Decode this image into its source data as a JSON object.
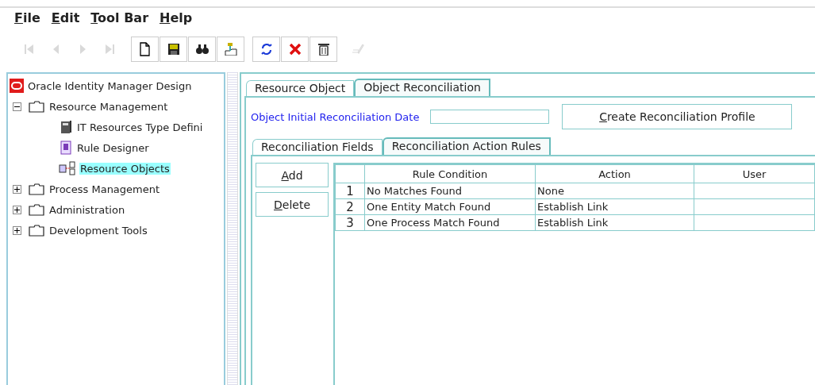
{
  "menu": [
    "File",
    "Edit",
    "Tool Bar",
    "Help"
  ],
  "toolbar": [
    [
      {
        "kind": "first",
        "disabled": true,
        "boxed": false
      },
      {
        "kind": "prev",
        "disabled": true,
        "boxed": false
      },
      {
        "kind": "next",
        "disabled": true,
        "boxed": false
      },
      {
        "kind": "last",
        "disabled": true,
        "boxed": false
      }
    ],
    [
      {
        "kind": "new",
        "disabled": false,
        "boxed": true
      },
      {
        "kind": "save",
        "disabled": false,
        "boxed": true
      },
      {
        "kind": "find",
        "disabled": false,
        "boxed": true
      },
      {
        "kind": "assign",
        "disabled": false,
        "boxed": true
      }
    ],
    [
      {
        "kind": "refresh",
        "disabled": false,
        "boxed": true
      },
      {
        "kind": "cancel",
        "disabled": false,
        "boxed": true
      },
      {
        "kind": "delete",
        "disabled": false,
        "boxed": true
      }
    ],
    [
      {
        "kind": "edit",
        "disabled": true,
        "boxed": false
      }
    ]
  ],
  "tree": {
    "label": "Oracle Identity Manager Design",
    "children": [
      {
        "label": "Resource Management",
        "kind": "folder",
        "expanded": true,
        "children": [
          {
            "label": "IT Resources Type Defini",
            "kind": "server",
            "selected": false
          },
          {
            "label": "Rule Designer",
            "kind": "rule",
            "selected": false
          },
          {
            "label": "Resource Objects",
            "kind": "object",
            "selected": true
          }
        ]
      },
      {
        "label": "Process Management",
        "kind": "folder",
        "expanded": false
      },
      {
        "label": "Administration",
        "kind": "folder",
        "expanded": false
      },
      {
        "label": "Development Tools",
        "kind": "folder",
        "expanded": false
      }
    ]
  },
  "tabs": [
    {
      "label": "Resource Object",
      "selected": false
    },
    {
      "label": "Object Reconciliation",
      "selected": true
    }
  ],
  "date_field": {
    "label": "Object Initial Reconciliation Date"
  },
  "profile_button": "Create Reconciliation Profile",
  "subtabs": [
    {
      "label": "Reconciliation Fields",
      "selected": false
    },
    {
      "label": "Reconciliation Action Rules",
      "selected": true
    }
  ],
  "side_buttons": [
    "Add",
    "Delete"
  ],
  "table": {
    "columns": [
      "Rule Condition",
      "Action",
      "User"
    ],
    "rows": [
      {
        "number": "1",
        "condition": "No Matches Found",
        "action": "None"
      },
      {
        "number": "2",
        "condition": "One Entity Match Found",
        "action": "Establish Link"
      },
      {
        "number": "3",
        "condition": "One Process Match Found",
        "action": "Establish Link"
      }
    ]
  }
}
